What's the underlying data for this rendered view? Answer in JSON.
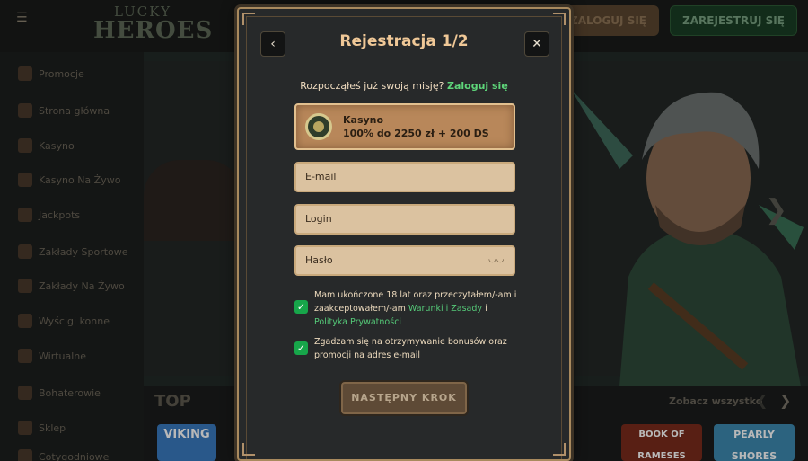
{
  "header": {
    "logo_line1": "LUCKY",
    "logo_line2": "HEROES",
    "login_label": "ZALOGUJ SIĘ",
    "register_label": "ZAREJESTRUJ SIĘ"
  },
  "sidebar": {
    "items": [
      {
        "label": "Promocje"
      },
      {
        "label": "Strona główna"
      },
      {
        "label": "Kasyno"
      },
      {
        "label": "Kasyno Na Żywo"
      },
      {
        "label": "Jackpots"
      },
      {
        "label": "Zakłady Sportowe"
      },
      {
        "label": "Zakłady Na Żywo"
      },
      {
        "label": "Wyścigi konne"
      },
      {
        "label": "Wirtualne"
      },
      {
        "label": "Bohaterowie"
      },
      {
        "label": "Sklep"
      },
      {
        "label": "Cotygodniowe"
      }
    ]
  },
  "games": {
    "section_title": "TOP",
    "see_all": "Zobacz wszystko",
    "tiles": [
      {
        "label": "VIKING"
      },
      {
        "label": "BOOK OF RAMESES"
      },
      {
        "label": "PEARLY SHORES"
      }
    ]
  },
  "modal": {
    "title": "Rejestracja 1/2",
    "already_text": "Rozpocząłeś już swoją misję?",
    "already_link": "Zaloguj się",
    "bonus": {
      "name": "Kasyno",
      "offer": "100% do 2250 zł + 200 DS"
    },
    "fields": {
      "email": "E-mail",
      "login": "Login",
      "password": "Hasło"
    },
    "consent_age": {
      "text1": "Mam ukończone 18 lat oraz przeczytałem/-am i zaakceptowałem/-am",
      "link1": "Warunki i Zasady",
      "mid": "i",
      "link2": "Polityka Prywatności",
      "checked": true
    },
    "consent_bonus": {
      "text": "Zgadzam się na otrzymywanie bonusów oraz promocji na adres e-mail",
      "checked": true
    },
    "next_label": "NASTĘPNY KROK"
  }
}
